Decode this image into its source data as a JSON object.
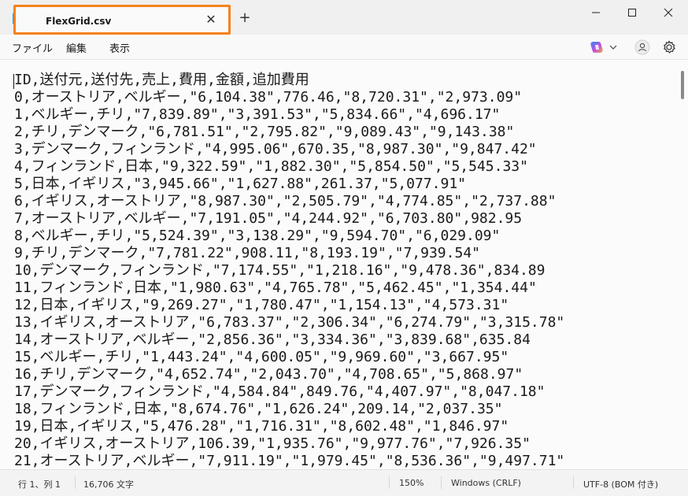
{
  "tab": {
    "title": "FlexGrid.csv",
    "close_glyph": "✕",
    "new_tab_glyph": "+"
  },
  "menu": {
    "file": "ファイル",
    "edit": "編集",
    "view": "表示"
  },
  "editor": {
    "lines": [
      "ID,送付元,送付先,売上,費用,金額,追加費用",
      "0,オーストリア,ベルギー,\"6,104.38\",776.46,\"8,720.31\",\"2,973.09\"",
      "1,ベルギー,チリ,\"7,839.89\",\"3,391.53\",\"5,834.66\",\"4,696.17\"",
      "2,チリ,デンマーク,\"6,781.51\",\"2,795.82\",\"9,089.43\",\"9,143.38\"",
      "3,デンマーク,フィンランド,\"4,995.06\",670.35,\"8,987.30\",\"9,847.42\"",
      "4,フィンランド,日本,\"9,322.59\",\"1,882.30\",\"5,854.50\",\"5,545.33\"",
      "5,日本,イギリス,\"3,945.66\",\"1,627.88\",261.37,\"5,077.91\"",
      "6,イギリス,オーストリア,\"8,987.30\",\"2,505.79\",\"4,774.85\",\"2,737.88\"",
      "7,オーストリア,ベルギー,\"7,191.05\",\"4,244.92\",\"6,703.80\",982.95",
      "8,ベルギー,チリ,\"5,524.39\",\"3,138.29\",\"9,594.70\",\"6,029.09\"",
      "9,チリ,デンマーク,\"7,781.22\",908.11,\"8,193.19\",\"7,939.54\"",
      "10,デンマーク,フィンランド,\"7,174.55\",\"1,218.16\",\"9,478.36\",834.89",
      "11,フィンランド,日本,\"1,980.63\",\"4,765.78\",\"5,462.45\",\"1,354.44\"",
      "12,日本,イギリス,\"9,269.27\",\"1,780.47\",\"1,154.13\",\"4,573.31\"",
      "13,イギリス,オーストリア,\"6,783.37\",\"2,306.34\",\"6,274.79\",\"3,315.78\"",
      "14,オーストリア,ベルギー,\"2,856.36\",\"3,334.36\",\"3,839.68\",635.84",
      "15,ベルギー,チリ,\"1,443.24\",\"4,600.05\",\"9,969.60\",\"3,667.95\"",
      "16,チリ,デンマーク,\"4,652.74\",\"2,043.70\",\"4,708.65\",\"5,868.97\"",
      "17,デンマーク,フィンランド,\"4,584.84\",849.76,\"4,407.97\",\"8,047.18\"",
      "18,フィンランド,日本,\"8,674.76\",\"1,626.24\",209.14,\"2,037.35\"",
      "19,日本,イギリス,\"5,476.28\",\"1,716.31\",\"8,602.48\",\"1,846.97\"",
      "20,イギリス,オーストリア,106.39,\"1,935.76\",\"9,977.76\",\"7,926.35\"",
      "21,オーストリア,ベルギー,\"7,911.19\",\"1,979.45\",\"8,536.36\",\"9,497.71\""
    ]
  },
  "status": {
    "position": "行 1、列 1",
    "char_count": "16,706 文字",
    "zoom": "150%",
    "line_ending": "Windows (CRLF)",
    "encoding": "UTF-8 (BOM 付き)"
  },
  "colors": {
    "tab_highlight": "#f5811f",
    "copilot_gradient": [
      "#2b88f0",
      "#c64fe0",
      "#f2a93b"
    ]
  },
  "icons": {
    "app": "notepad-icon",
    "minimize": "minimize-icon",
    "maximize": "maximize-icon",
    "close": "close-icon",
    "copilot": "copilot-icon",
    "profile": "profile-icon",
    "settings": "gear-icon"
  }
}
